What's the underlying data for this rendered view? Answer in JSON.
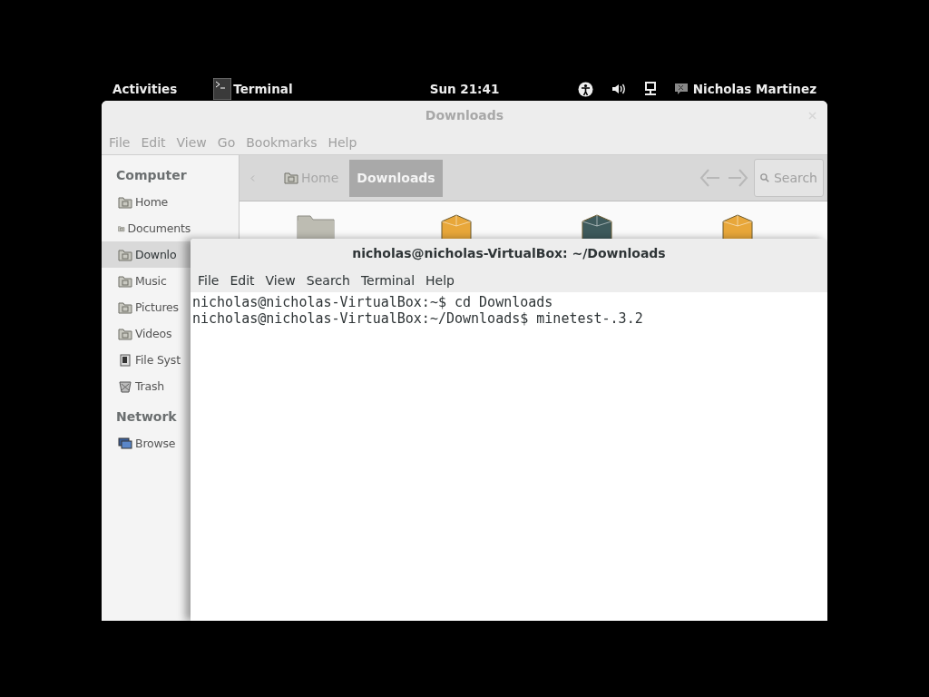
{
  "top_bar": {
    "activities": "Activities",
    "app": "Terminal",
    "clock": "Sun 21:41",
    "user": "Nicholas Martinez"
  },
  "file_manager": {
    "title": "Downloads",
    "active": false,
    "menu": [
      "File",
      "Edit",
      "View",
      "Go",
      "Bookmarks",
      "Help"
    ],
    "sidebar": [
      {
        "heading": "Computer",
        "items": [
          {
            "label": "Home",
            "kind": "folder",
            "selected": false
          },
          {
            "label": "Documents",
            "kind": "folder",
            "selected": false
          },
          {
            "label": "Downlo",
            "kind": "folder",
            "selected": true
          },
          {
            "label": "Music",
            "kind": "folder",
            "selected": false
          },
          {
            "label": "Pictures",
            "kind": "folder",
            "selected": false
          },
          {
            "label": "Videos",
            "kind": "folder",
            "selected": false
          },
          {
            "label": "File Syst",
            "kind": "drive",
            "selected": false
          },
          {
            "label": "Trash",
            "kind": "trash",
            "selected": false
          }
        ]
      },
      {
        "heading": "Network",
        "items": [
          {
            "label": "Browse",
            "kind": "network",
            "selected": false
          }
        ]
      }
    ],
    "breadcrumbs": [
      {
        "label": "Home",
        "selected": false
      },
      {
        "label": "Downloads",
        "selected": true
      }
    ],
    "search_button": "Search",
    "files": [
      {
        "kind": "folder",
        "color": "#bdbcb2"
      },
      {
        "kind": "package",
        "color": "#e8a73a"
      },
      {
        "kind": "package",
        "color": "#3e5a5c"
      },
      {
        "kind": "package",
        "color": "#e8a73a"
      }
    ]
  },
  "terminal": {
    "title": "nicholas@nicholas-VirtualBox: ~/Downloads",
    "active": true,
    "menu": [
      "File",
      "Edit",
      "View",
      "Search",
      "Terminal",
      "Help"
    ],
    "lines": [
      "nicholas@nicholas-VirtualBox:~$ cd Downloads",
      "nicholas@nicholas-VirtualBox:~/Downloads$ minetest-.3.2"
    ]
  }
}
